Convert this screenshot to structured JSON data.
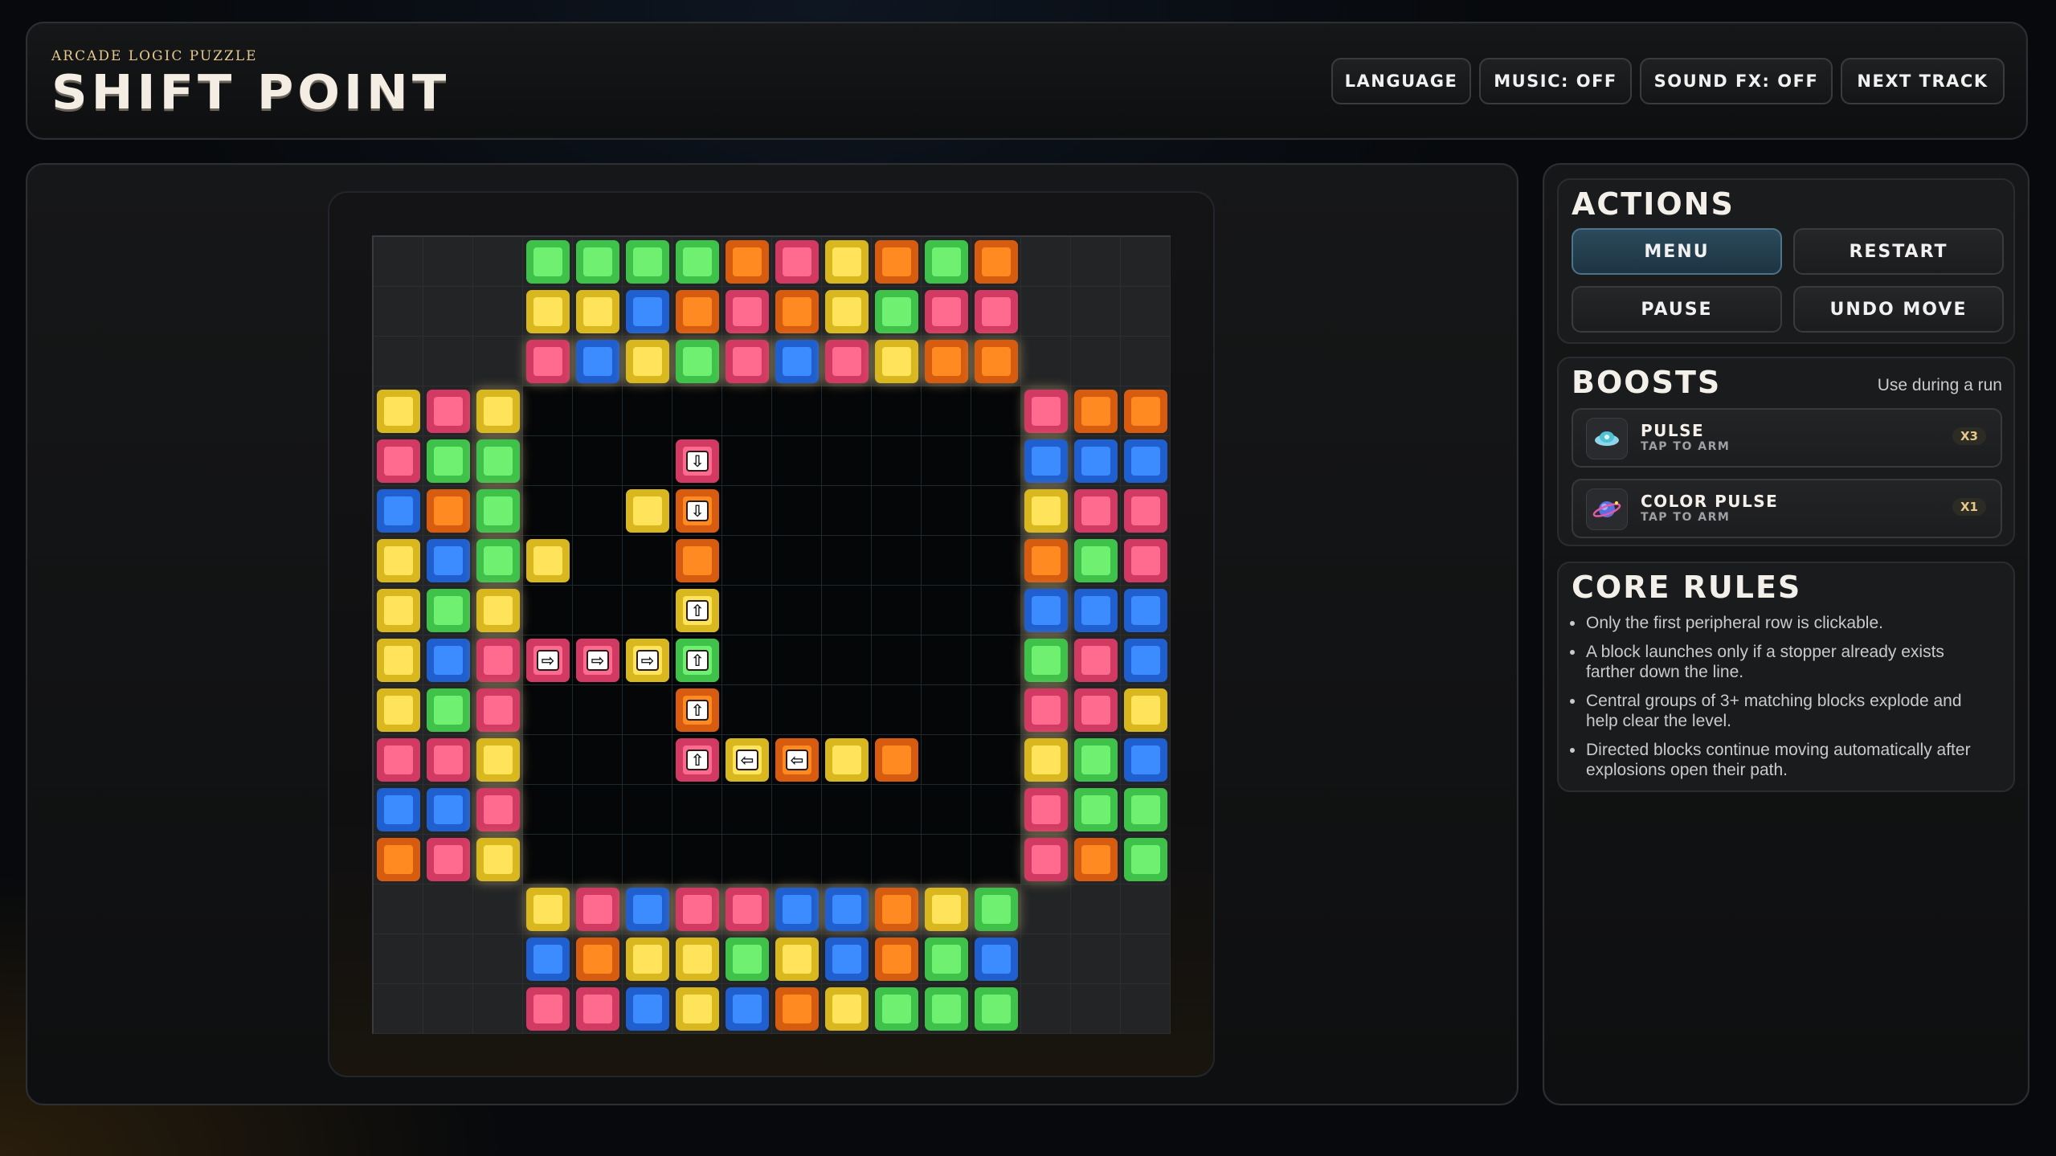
{
  "header": {
    "subtitle": "ARCADE LOGIC PUZZLE",
    "title": "SHIFT POINT",
    "buttons": [
      {
        "id": "language",
        "label": "LANGUAGE"
      },
      {
        "id": "music",
        "label": "MUSIC: OFF"
      },
      {
        "id": "sfx",
        "label": "SOUND FX: OFF"
      },
      {
        "id": "next",
        "label": "NEXT TRACK"
      }
    ]
  },
  "actions": {
    "title": "ACTIONS",
    "buttons": [
      {
        "id": "menu",
        "label": "MENU",
        "active": true
      },
      {
        "id": "restart",
        "label": "RESTART",
        "active": false
      },
      {
        "id": "pause",
        "label": "PAUSE",
        "active": false
      },
      {
        "id": "undo",
        "label": "UNDO MOVE",
        "active": false
      }
    ]
  },
  "boosts": {
    "title": "BOOSTS",
    "hint": "Use during a run",
    "items": [
      {
        "name": "PULSE",
        "sub": "TAP TO ARM",
        "count": "X3",
        "icon": "pulse-icon"
      },
      {
        "name": "COLOR PULSE",
        "sub": "TAP TO ARM",
        "count": "X1",
        "icon": "color-pulse-icon"
      }
    ]
  },
  "rules": {
    "title": "CORE RULES",
    "items": [
      "Only the first peripheral row is clickable.",
      "A block launches only if a stopper already exists farther down the line.",
      "Central groups of 3+ matching blocks explode and help clear the level.",
      "Directed blocks continue moving automatically after explosions open their path."
    ]
  },
  "colors": {
    "G": {
      "outer": "#3fc24a",
      "inner": "#6ff070"
    },
    "Y": {
      "outer": "#d9b81f",
      "inner": "#ffe35a"
    },
    "B": {
      "outer": "#1f5fcf",
      "inner": "#3d8cff"
    },
    "O": {
      "outer": "#d85c10",
      "inner": "#ff8a22"
    },
    "P": {
      "outer": "#d33a63",
      "inner": "#ff6b8e"
    }
  },
  "board": {
    "size": 16,
    "rows": [
      "...GGGGOPYOGO...",
      "...YYBOPOYGPP...",
      "...PBYGPBPYOO...",
      "YPY..........POO",
      "PGG..........BBB",
      "BOG..........YPP",
      "YBGY.........OGP",
      "YGY..........BBB",
      "YBPPPYG......GPB",
      "YGP..........PPY",
      "PPY.....PYO..YGB",
      "BBP..........PGG",
      "OPY..........POG",
      "...YPBPPBBOYG...",
      "...BOYYGYBOGB...",
      "...PPBYBOYGGG..."
    ],
    "center_blocks": [
      {
        "r": 4,
        "c": 6,
        "color": "P",
        "arrow": "down"
      },
      {
        "r": 5,
        "c": 5,
        "color": "Y",
        "arrow": ""
      },
      {
        "r": 5,
        "c": 6,
        "color": "O",
        "arrow": "down"
      },
      {
        "r": 6,
        "c": 6,
        "color": "O",
        "arrow": ""
      },
      {
        "r": 7,
        "c": 6,
        "color": "Y",
        "arrow": "up"
      },
      {
        "r": 8,
        "c": 6,
        "color": "G",
        "arrow": "up"
      },
      {
        "r": 8,
        "c": 3,
        "color": "P",
        "arrow": "right"
      },
      {
        "r": 8,
        "c": 4,
        "color": "P",
        "arrow": "right"
      },
      {
        "r": 8,
        "c": 5,
        "color": "Y",
        "arrow": "right"
      },
      {
        "r": 9,
        "c": 6,
        "color": "O",
        "arrow": "up"
      },
      {
        "r": 10,
        "c": 6,
        "color": "P",
        "arrow": "up"
      },
      {
        "r": 10,
        "c": 7,
        "color": "Y",
        "arrow": "left"
      },
      {
        "r": 10,
        "c": 8,
        "color": "O",
        "arrow": "left"
      }
    ]
  }
}
